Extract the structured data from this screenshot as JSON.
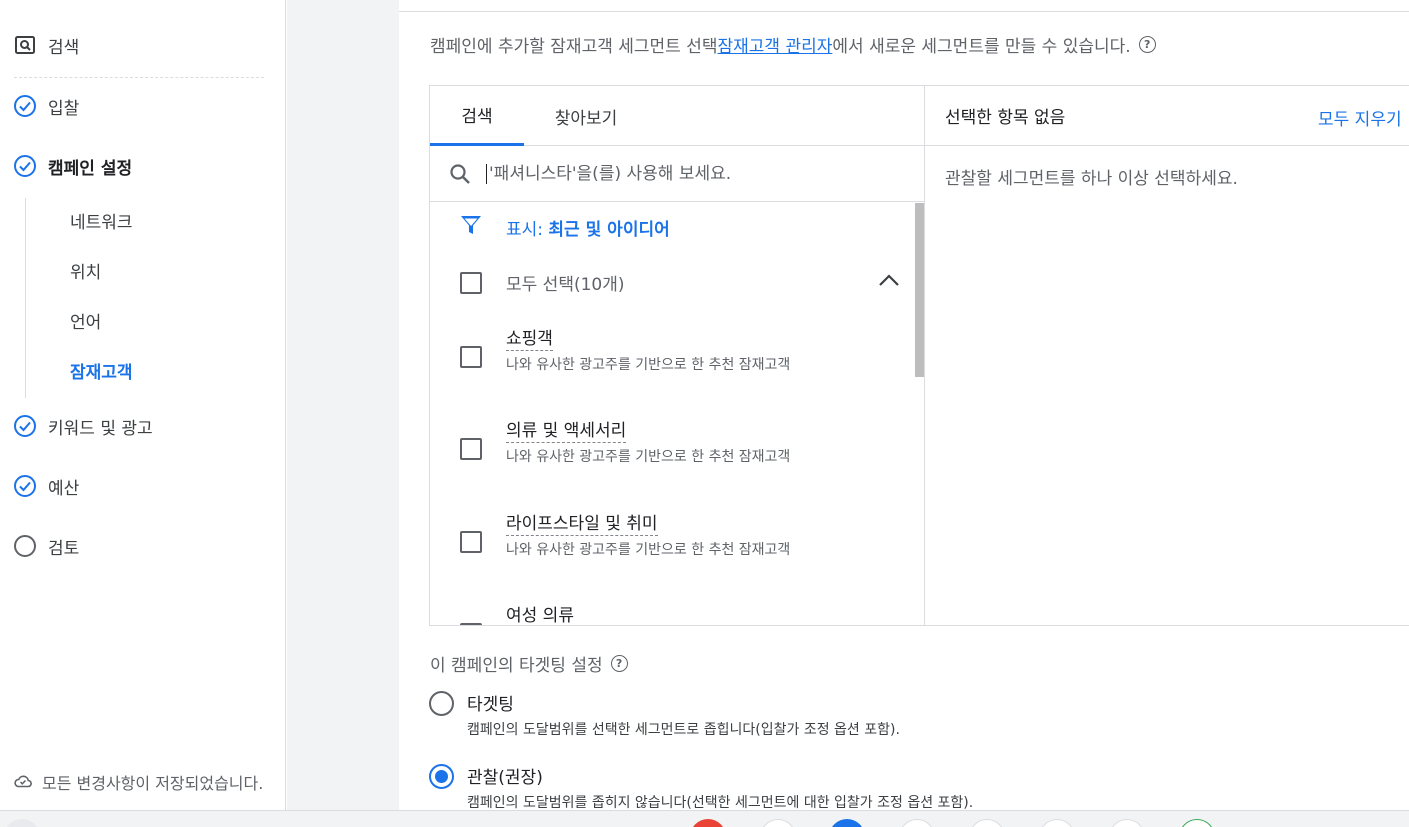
{
  "sidebar": {
    "search_label": "검색",
    "items": [
      {
        "label": "입찰"
      },
      {
        "label": "캠페인 설정"
      },
      {
        "label": "키워드 및 광고"
      },
      {
        "label": "예산"
      },
      {
        "label": "검토"
      }
    ],
    "sub_items": [
      {
        "label": "네트워크"
      },
      {
        "label": "위치"
      },
      {
        "label": "언어"
      },
      {
        "label": "잠재고객"
      }
    ],
    "saved_text": "모든 변경사항이 저장되었습니다."
  },
  "intro": {
    "prefix": "캠페인에 추가할 잠재고객 세그먼트 선택 ",
    "link": "잠재고객 관리자",
    "suffix": "에서 새로운 세그먼트를 만들 수 있습니다."
  },
  "selector": {
    "tabs": [
      {
        "label": "검색"
      },
      {
        "label": "찾아보기"
      }
    ],
    "search_placeholder": "'패셔니스타'을(를) 사용해 보세요.",
    "filter_prefix": "표시: ",
    "filter_value": "최근 및 아이디어",
    "select_all": "모두 선택(10개)",
    "segments": [
      {
        "name": "쇼핑객",
        "desc": "나와 유사한 광고주를 기반으로 한 추천 잠재고객"
      },
      {
        "name": "의류 및 액세서리",
        "desc": "나와 유사한 광고주를 기반으로 한 추천 잠재고객"
      },
      {
        "name": "라이프스타일 및 취미",
        "desc": "나와 유사한 광고주를 기반으로 한 추천 잠재고객"
      },
      {
        "name": "여성 의류",
        "desc": ""
      }
    ],
    "right_title": "선택한 항목 없음",
    "clear_all": "모두 지우기",
    "right_empty": "관찰할 세그먼트를 하나 이상 선택하세요."
  },
  "targeting": {
    "title": "이 캠페인의 타겟팅 설정",
    "options": [
      {
        "label": "타겟팅",
        "desc": "캠페인의 도달범위를 선택한 세그먼트로 좁힙니다(입찰가 조정 옵션 포함)."
      },
      {
        "label": "관찰(권장)",
        "desc": "캠페인의 도달범위를 좁히지 않습니다(선택한 세그먼트에 대한 입찰가 조정 옵션 포함)."
      }
    ],
    "selected": "관찰(권장)"
  },
  "colors": {
    "accent": "#1a73e8",
    "text": "#3c4043",
    "muted": "#5f6368",
    "border": "#dadce0"
  }
}
